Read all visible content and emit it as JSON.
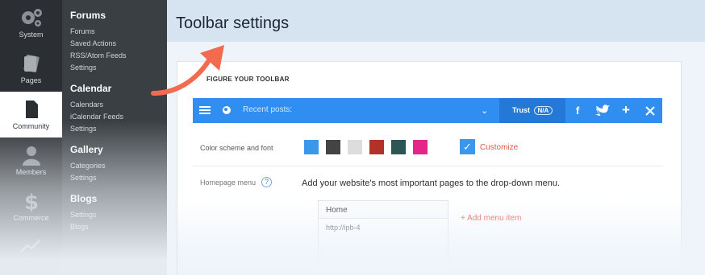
{
  "rail": {
    "items": [
      {
        "label": "System",
        "icon": "gears-icon"
      },
      {
        "label": "Pages",
        "icon": "pages-icon"
      },
      {
        "label": "Community",
        "icon": "document-icon",
        "active": true
      },
      {
        "label": "Members",
        "icon": "person-icon"
      },
      {
        "label": "Commerce",
        "icon": "dollar-icon"
      }
    ]
  },
  "submenu": {
    "forums": {
      "title": "Forums",
      "links": [
        "Forums",
        "Saved Actions",
        "RSS/Atom Feeds",
        "Settings"
      ]
    },
    "calendar": {
      "title": "Calendar",
      "links": [
        "Calendars",
        "iCalendar Feeds",
        "Settings"
      ]
    },
    "gallery": {
      "title": "Gallery",
      "links": [
        "Categories",
        "Settings"
      ]
    },
    "blogs": {
      "title": "Blogs",
      "links": [
        "Settings",
        "Blogs"
      ]
    }
  },
  "header": {
    "title": "Toolbar settings"
  },
  "panel": {
    "section_title": "FIGURE YOUR TOOLBAR",
    "toolbar": {
      "recent_label": "Recent posts:",
      "trust_label": "Trust",
      "trust_badge": "N/A",
      "social": [
        "f",
        "t",
        "+",
        "x"
      ]
    },
    "color_scheme_label": "Color scheme and font",
    "swatches": [
      "#3a97ec",
      "#444444",
      "#dddddd",
      "#b2322a",
      "#2f5454",
      "#e4258a"
    ],
    "customize_label": "Customize",
    "homepage_menu_label": "Homepage menu",
    "homepage_help": "?",
    "homepage_desc": "Add your website's most important pages to the drop-down menu.",
    "menu_item": {
      "name": "Home",
      "url": "http://ipb-4"
    },
    "add_menu_item": "+ Add menu item"
  },
  "colors": {
    "accent": "#2f8ef0",
    "arrow": "#f26b4f",
    "rail": "#2b2f33",
    "submenu": "#3a3f44"
  }
}
